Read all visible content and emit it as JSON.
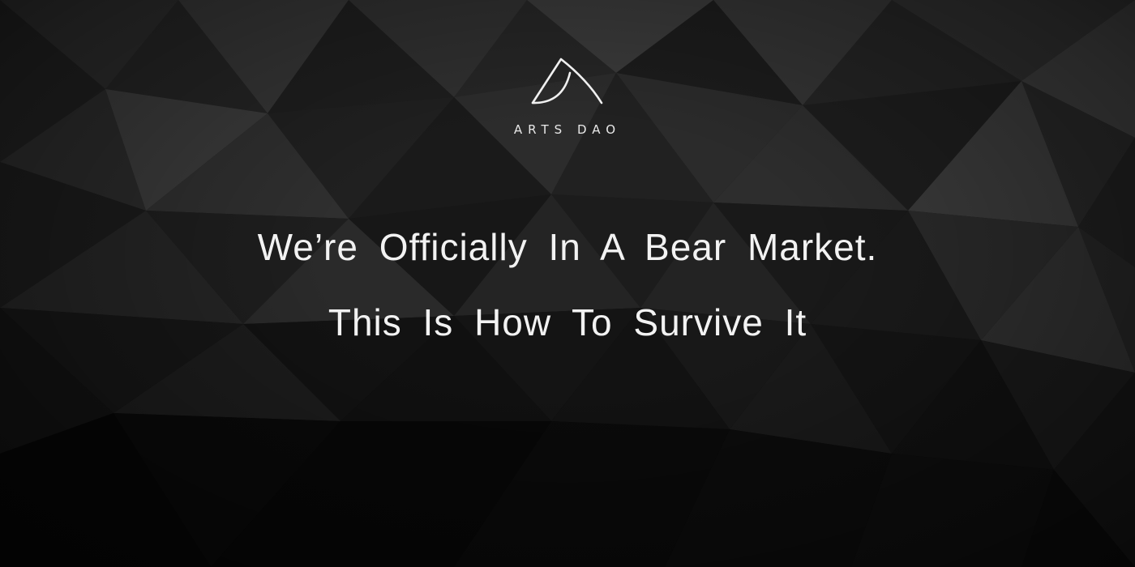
{
  "brand": {
    "name": "ARTS DAO"
  },
  "headline": {
    "line1": "We’re Officially In A Bear Market.",
    "line2": "This Is How To Survive It"
  },
  "colors": {
    "background": "#050505",
    "text": "#f2f2f2"
  },
  "icons": {
    "logo": "arts-dao-logo-mark"
  }
}
